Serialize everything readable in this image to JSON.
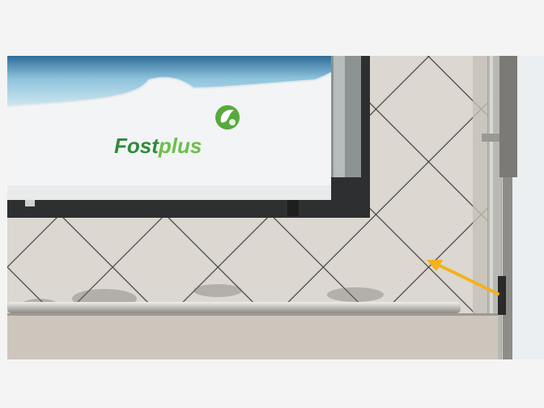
{
  "photo": {
    "billboard": {
      "brand_part1": "Fost",
      "brand_part2": "plus",
      "brand_color_dark": "#2f8a3c",
      "brand_color_light": "#6cc04a",
      "logo": "recycle-leaf-icon"
    },
    "annotation": {
      "arrow_color": "#f2b21a",
      "icon": "arrow-icon"
    }
  }
}
